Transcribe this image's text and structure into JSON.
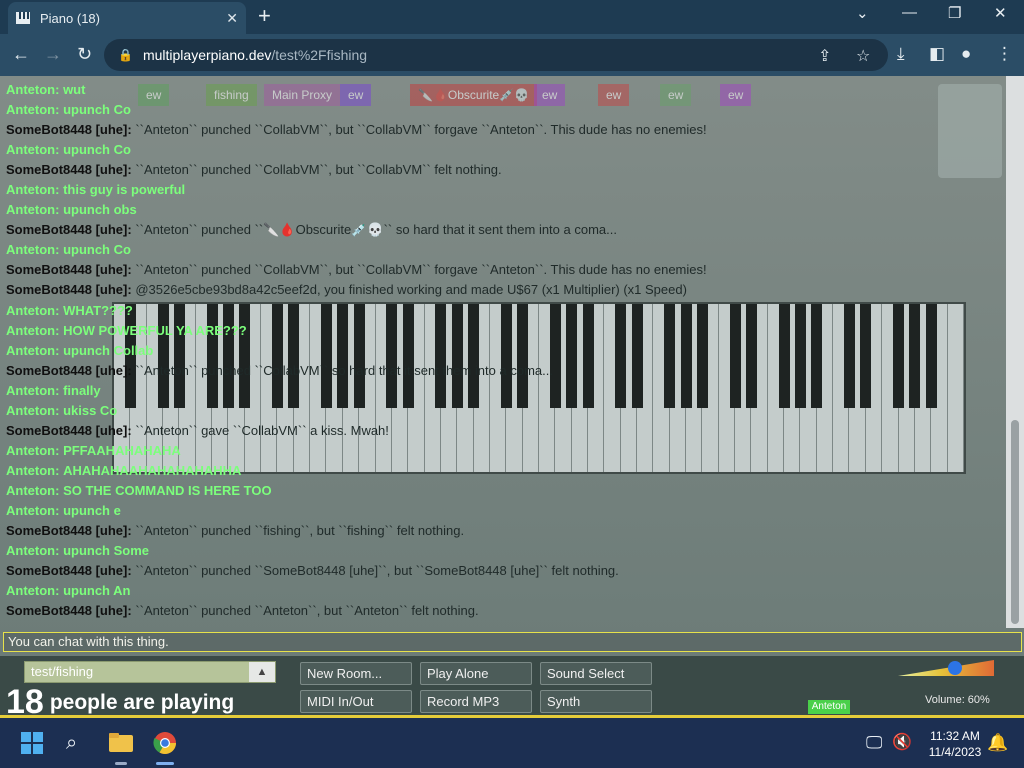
{
  "browser": {
    "tab_title": "Piano (18)",
    "tab_close": "✕",
    "new_tab": "+",
    "url_host": "multiplayerpiano.dev",
    "url_path": "/test%2Ffishing"
  },
  "chat": {
    "messages": [
      {
        "who": "Anteton:",
        "text": "wut",
        "kind": "anteton"
      },
      {
        "who": "Anteton:",
        "text": "upunch Co",
        "kind": "anteton"
      },
      {
        "who": "SomeBot8448 [uhe]:",
        "text": "``Anteton`` punched ``CollabVM``, but ``CollabVM`` forgave ``Anteton``. This dude has no enemies!",
        "kind": "somebot"
      },
      {
        "who": "Anteton:",
        "text": "upunch Co",
        "kind": "anteton"
      },
      {
        "who": "SomeBot8448 [uhe]:",
        "text": "``Anteton`` punched ``CollabVM``, but ``CollabVM`` felt nothing.",
        "kind": "somebot"
      },
      {
        "who": "Anteton:",
        "text": "this guy is powerful",
        "kind": "anteton"
      },
      {
        "who": "Anteton:",
        "text": "upunch obs",
        "kind": "anteton"
      },
      {
        "who": "SomeBot8448 [uhe]:",
        "text": "``Anteton`` punched ``🔪🩸Obscurite💉💀`` so hard that it sent them into a coma...",
        "kind": "somebot"
      },
      {
        "who": "Anteton:",
        "text": "upunch Co",
        "kind": "anteton"
      },
      {
        "who": "SomeBot8448 [uhe]:",
        "text": "``Anteton`` punched ``CollabVM``, but ``CollabVM`` forgave ``Anteton``. This dude has no enemies!",
        "kind": "somebot"
      },
      {
        "who": "SomeBot8448 [uhe]:",
        "text": "@3526e5cbe93bd8a42c5eef2d, you finished working and made U$67 (x1 Multiplier) (x1 Speed)",
        "kind": "somebot"
      },
      {
        "who": "Anteton:",
        "text": "WHAT????",
        "kind": "anteton"
      },
      {
        "who": "Anteton:",
        "text": "HOW POWERFUL YA ARE???",
        "kind": "anteton"
      },
      {
        "who": "Anteton:",
        "text": "upunch Collab",
        "kind": "anteton"
      },
      {
        "who": "SomeBot8448 [uhe]:",
        "text": "``Anteton`` punched ``CollabVM`` so hard that it sent them into a coma...",
        "kind": "somebot"
      },
      {
        "who": "Anteton:",
        "text": "finally",
        "kind": "anteton"
      },
      {
        "who": "Anteton:",
        "text": "ukiss Co",
        "kind": "anteton"
      },
      {
        "who": "SomeBot8448 [uhe]:",
        "text": "``Anteton`` gave ``CollabVM`` a kiss. Mwah!",
        "kind": "somebot"
      },
      {
        "who": "Anteton:",
        "text": "PFFAAHAHAHAHA",
        "kind": "anteton"
      },
      {
        "who": "Anteton:",
        "text": "AHAHAHAAHAHAHAHAHHA",
        "kind": "anteton"
      },
      {
        "who": "Anteton:",
        "text": "SO THE COMMAND IS HERE TOO",
        "kind": "anteton"
      },
      {
        "who": "Anteton:",
        "text": "upunch e",
        "kind": "anteton"
      },
      {
        "who": "SomeBot8448 [uhe]:",
        "text": "``Anteton`` punched ``fishing``, but ``fishing`` felt nothing.",
        "kind": "somebot"
      },
      {
        "who": "Anteton:",
        "text": "upunch Some",
        "kind": "anteton"
      },
      {
        "who": "SomeBot8448 [uhe]:",
        "text": "``Anteton`` punched ``SomeBot8448 [uhe]``, but ``SomeBot8448 [uhe]`` felt nothing.",
        "kind": "somebot"
      },
      {
        "who": "Anteton:",
        "text": "upunch An",
        "kind": "anteton"
      },
      {
        "who": "SomeBot8448 [uhe]:",
        "text": "``Anteton`` punched ``Anteton``, but ``Anteton`` felt nothing.",
        "kind": "somebot"
      }
    ],
    "input_placeholder": "You can chat with this thing."
  },
  "userbar": {
    "chips": [
      {
        "label": "ew",
        "color": "#5ea05e"
      },
      {
        "label": "fishing",
        "color": "#6aa04e"
      },
      {
        "label": "Main Proxy",
        "color": "#a05ea0"
      },
      {
        "label": "ew",
        "color": "#7a4ad0"
      },
      {
        "label": "🔪🩸Obscurite💉💀",
        "color": "#c04040"
      },
      {
        "label": "ew",
        "color": "#9a4ac0"
      },
      {
        "label": "ew",
        "color": "#c04a4a"
      },
      {
        "label": "ew",
        "color": "#6aa06a"
      },
      {
        "label": "ew",
        "color": "#a04ac0"
      }
    ]
  },
  "controls": {
    "room_name": "test/fishing",
    "room_arrow": "▲",
    "people_count": "18",
    "people_label": "people are playing",
    "buttons": [
      {
        "label": "New Room..."
      },
      {
        "label": "Play Alone"
      },
      {
        "label": "Sound Select"
      },
      {
        "label": "MIDI In/Out"
      },
      {
        "label": "Record MP3"
      },
      {
        "label": "Synth"
      }
    ],
    "volume_label": "Volume: 60%",
    "volume_level": 0.6,
    "anteton_badge": "Anteton"
  },
  "taskbar": {
    "time": "11:32 AM",
    "date": "11/4/2023"
  },
  "colors": {
    "anteton": "#7cff7c",
    "accent_yellow": "#e5cc3a"
  }
}
